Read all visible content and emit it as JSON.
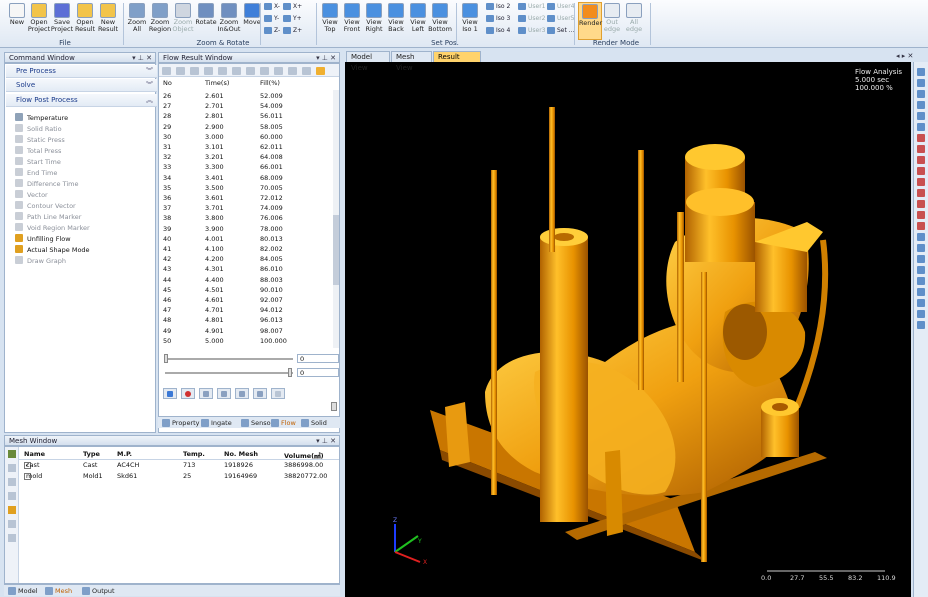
{
  "ribbon": {
    "buttons": [
      {
        "label": "New",
        "name": "new-button"
      },
      {
        "label": "Open Project",
        "name": "open-project-button"
      },
      {
        "label": "Save Project",
        "name": "save-project-button"
      },
      {
        "label": "Open Result",
        "name": "open-result-button"
      },
      {
        "label": "New Result",
        "name": "new-result-button"
      },
      {
        "label": "Zoom All",
        "name": "zoom-all-button"
      },
      {
        "label": "Zoom Region",
        "name": "zoom-region-button"
      },
      {
        "label": "Zoom Object",
        "name": "zoom-object-button"
      },
      {
        "label": "Rotate",
        "name": "rotate-button"
      },
      {
        "label": "Zoom In&Out",
        "name": "zoom-in-out-button"
      },
      {
        "label": "Move",
        "name": "move-button"
      },
      {
        "label": "View Top",
        "name": "view-top-button"
      },
      {
        "label": "View Front",
        "name": "view-front-button"
      },
      {
        "label": "View Right",
        "name": "view-right-button"
      },
      {
        "label": "View Back",
        "name": "view-back-button"
      },
      {
        "label": "View Left",
        "name": "view-left-button"
      },
      {
        "label": "View Bottom",
        "name": "view-bottom-button"
      },
      {
        "label": "View Iso 1",
        "name": "view-iso1-button"
      },
      {
        "label": "Render",
        "name": "render-button"
      },
      {
        "label": "Out edge",
        "name": "out-edge-button"
      },
      {
        "label": "All edge",
        "name": "all-edge-button"
      }
    ],
    "mini": [
      "X-",
      "X+",
      "Y-",
      "Y+",
      "Z-",
      "Z+",
      "Iso 2",
      "Iso 3",
      "Iso 4",
      "User1",
      "User2",
      "User3",
      "User4",
      "User5",
      "Set ..."
    ],
    "groups": [
      "File",
      "Zoom & Rotate",
      "Set Pos.",
      "Render Mode"
    ]
  },
  "command_window": {
    "title": "Command Window",
    "sections": [
      "Pre Process",
      "Solve",
      "Flow Post Process"
    ],
    "items": [
      {
        "label": "Temperature",
        "enabled": true
      },
      {
        "label": "Solid Ratio",
        "enabled": false
      },
      {
        "label": "Static Press",
        "enabled": false
      },
      {
        "label": "Total Press",
        "enabled": false
      },
      {
        "label": "Start Time",
        "enabled": false
      },
      {
        "label": "End Time",
        "enabled": false
      },
      {
        "label": "Difference Time",
        "enabled": false
      },
      {
        "label": "Vector",
        "enabled": false
      },
      {
        "label": "Contour Vector",
        "enabled": false
      },
      {
        "label": "Path Line Marker",
        "enabled": false
      },
      {
        "label": "Void Region Marker",
        "enabled": false
      },
      {
        "label": "Unfilling Flow",
        "enabled": true
      },
      {
        "label": "Actual Shape Mode",
        "enabled": true
      },
      {
        "label": "Draw Graph",
        "enabled": false
      }
    ]
  },
  "flow_result": {
    "title": "Flow Result Window",
    "columns": [
      "No",
      "Time(s)",
      "Fill(%)"
    ],
    "rows": [
      [
        "26",
        "2.601",
        "52.009"
      ],
      [
        "27",
        "2.701",
        "54.009"
      ],
      [
        "28",
        "2.801",
        "56.011"
      ],
      [
        "29",
        "2.900",
        "58.005"
      ],
      [
        "30",
        "3.000",
        "60.000"
      ],
      [
        "31",
        "3.101",
        "62.011"
      ],
      [
        "32",
        "3.201",
        "64.008"
      ],
      [
        "33",
        "3.300",
        "66.001"
      ],
      [
        "34",
        "3.401",
        "68.009"
      ],
      [
        "35",
        "3.500",
        "70.005"
      ],
      [
        "36",
        "3.601",
        "72.012"
      ],
      [
        "37",
        "3.701",
        "74.009"
      ],
      [
        "38",
        "3.800",
        "76.006"
      ],
      [
        "39",
        "3.900",
        "78.000"
      ],
      [
        "40",
        "4.001",
        "80.013"
      ],
      [
        "41",
        "4.100",
        "82.002"
      ],
      [
        "42",
        "4.200",
        "84.005"
      ],
      [
        "43",
        "4.301",
        "86.010"
      ],
      [
        "44",
        "4.400",
        "88.003"
      ],
      [
        "45",
        "4.501",
        "90.010"
      ],
      [
        "46",
        "4.601",
        "92.007"
      ],
      [
        "47",
        "4.701",
        "94.012"
      ],
      [
        "48",
        "4.801",
        "96.013"
      ],
      [
        "49",
        "4.901",
        "98.007"
      ],
      [
        "50",
        "5.000",
        "100.000"
      ]
    ],
    "slider_value1": "0",
    "slider_value2": "0",
    "tabs": [
      "Property",
      "Ingate",
      "Sensor",
      "Flow",
      "Solid"
    ]
  },
  "mesh_window": {
    "title": "Mesh Window",
    "columns": [
      "Name",
      "Type",
      "M.P.",
      "Temp.",
      "No. Mesh",
      "Volume(㎣)"
    ],
    "rows": [
      {
        "checked": true,
        "cells": [
          "cast",
          "Cast",
          "AC4CH",
          "713",
          "1918926",
          "3886998.00"
        ]
      },
      {
        "checked": false,
        "cells": [
          "mold",
          "Mold1",
          "Skd61",
          "25",
          "19164969",
          "38820772.00"
        ]
      }
    ],
    "tabs": [
      "Model",
      "Mesh",
      "Output"
    ]
  },
  "viewport": {
    "tabs": [
      "Model View",
      "Mesh View",
      "Result View"
    ],
    "active_tab": "Result View",
    "overlay": [
      "Flow Analysis",
      "5.000 sec",
      "100.000 %"
    ],
    "scale_labels": [
      "0.0",
      "27.7",
      "55.5",
      "83.2",
      "110.9"
    ],
    "axes": [
      "X",
      "Y",
      "Z"
    ],
    "model_color": "#f0a010"
  }
}
